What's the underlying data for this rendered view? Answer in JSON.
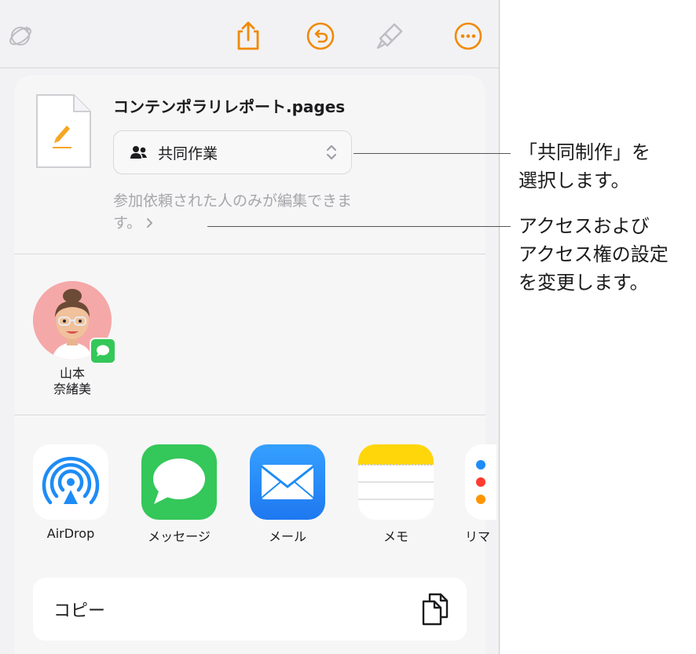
{
  "toolbar": {
    "icons": [
      "magic-icon",
      "share-icon",
      "undo-icon",
      "paintbrush-icon",
      "more-icon"
    ]
  },
  "document": {
    "title": "コンテンポラリレポート.pages",
    "mode_label": "共同作業",
    "access_text": "参加依頼された人のみが編集できます。"
  },
  "person": {
    "name_line1": "山本",
    "name_line2": "奈緒美"
  },
  "apps": [
    {
      "label": "AirDrop"
    },
    {
      "label": "メッセージ"
    },
    {
      "label": "メール"
    },
    {
      "label": "メモ"
    },
    {
      "label": "リマ"
    }
  ],
  "copy": {
    "label": "コピー"
  },
  "callouts": {
    "collab_line1": "「共同制作」を",
    "collab_line2": "選択します。",
    "access_line1": "アクセスおよび",
    "access_line2": "アクセス権の設定",
    "access_line3": "を変更します。"
  },
  "colors": {
    "accent": "#f08a00",
    "background": "#f2f2f4",
    "messages_green": "#34c759",
    "mail_blue": "#1e8cf6"
  }
}
